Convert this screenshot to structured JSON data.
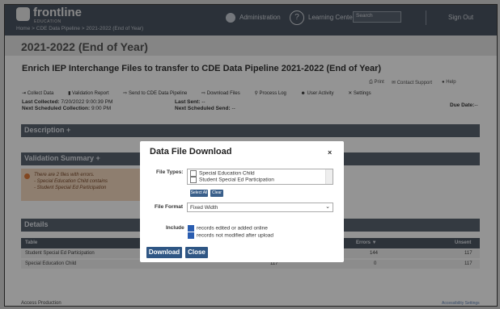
{
  "header": {
    "logo": "frontline",
    "logo_sub": "EDUCATION",
    "breadcrumb": "Home > CDE Data Pipeline > 2021-2022 (End of Year)",
    "admin_label": "Administration",
    "learning_label": "Learning Center",
    "search_placeholder": "Search",
    "signout_label": "Sign Out"
  },
  "page": {
    "title": "2021-2022 (End of Year)",
    "heading": "Enrich IEP Interchange Files to transfer to CDE Data Pipeline 2021-2022 (End of Year)"
  },
  "utilities": {
    "print": "Print",
    "contact": "Contact Support",
    "help": "Help"
  },
  "toolbar": {
    "collect": "Collect Data",
    "validation": "Validation Report",
    "send": "Send to CDE Data Pipeline",
    "download": "Download Files",
    "process": "Process Log",
    "activity": "User Activity",
    "settings": "Settings"
  },
  "meta": {
    "last_collected_label": "Last Collected:",
    "last_collected_value": "7/20/2022 9:00:39 PM",
    "next_collection_label": "Next Scheduled Collection:",
    "next_collection_value": "9:00 PM",
    "last_sent_label": "Last Sent:",
    "last_sent_value": "--",
    "next_send_label": "Next Scheduled Send:",
    "next_send_value": "--",
    "due_label": "Due Date:",
    "due_value": "--"
  },
  "sections": {
    "description": "Description +",
    "validation": "Validation Summary +",
    "details": "Details"
  },
  "alert": {
    "line1": "There are 2 files with errors.",
    "line2": "- Special Education Child contains",
    "line3": "- Student Special Ed Participation"
  },
  "table": {
    "headers": {
      "table": "Table",
      "errors": "Errors ▼",
      "unsent": "Unsent"
    },
    "rows": [
      {
        "name": "Student Special Ed Participation",
        "errors": "144",
        "unsent": "117"
      },
      {
        "name": "Special Education Child",
        "mid": "117",
        "errors": "0",
        "unsent": "117"
      }
    ]
  },
  "footer": {
    "left": "Access Production",
    "right": "Accessibility Settings"
  },
  "modal": {
    "title": "Data File Download",
    "close_symbol": "×",
    "file_types_label": "File Types:",
    "file_type_options": [
      "Special Education Child",
      "Student Special Ed Participation"
    ],
    "select_all": "Select All",
    "clear": "Clear",
    "file_format_label": "File Format",
    "file_format_value": "Fixed Width",
    "include_label": "Include",
    "include_options": [
      "records edited or added online",
      "records not modified after upload"
    ],
    "download_button": "Download",
    "close_button": "Close"
  }
}
